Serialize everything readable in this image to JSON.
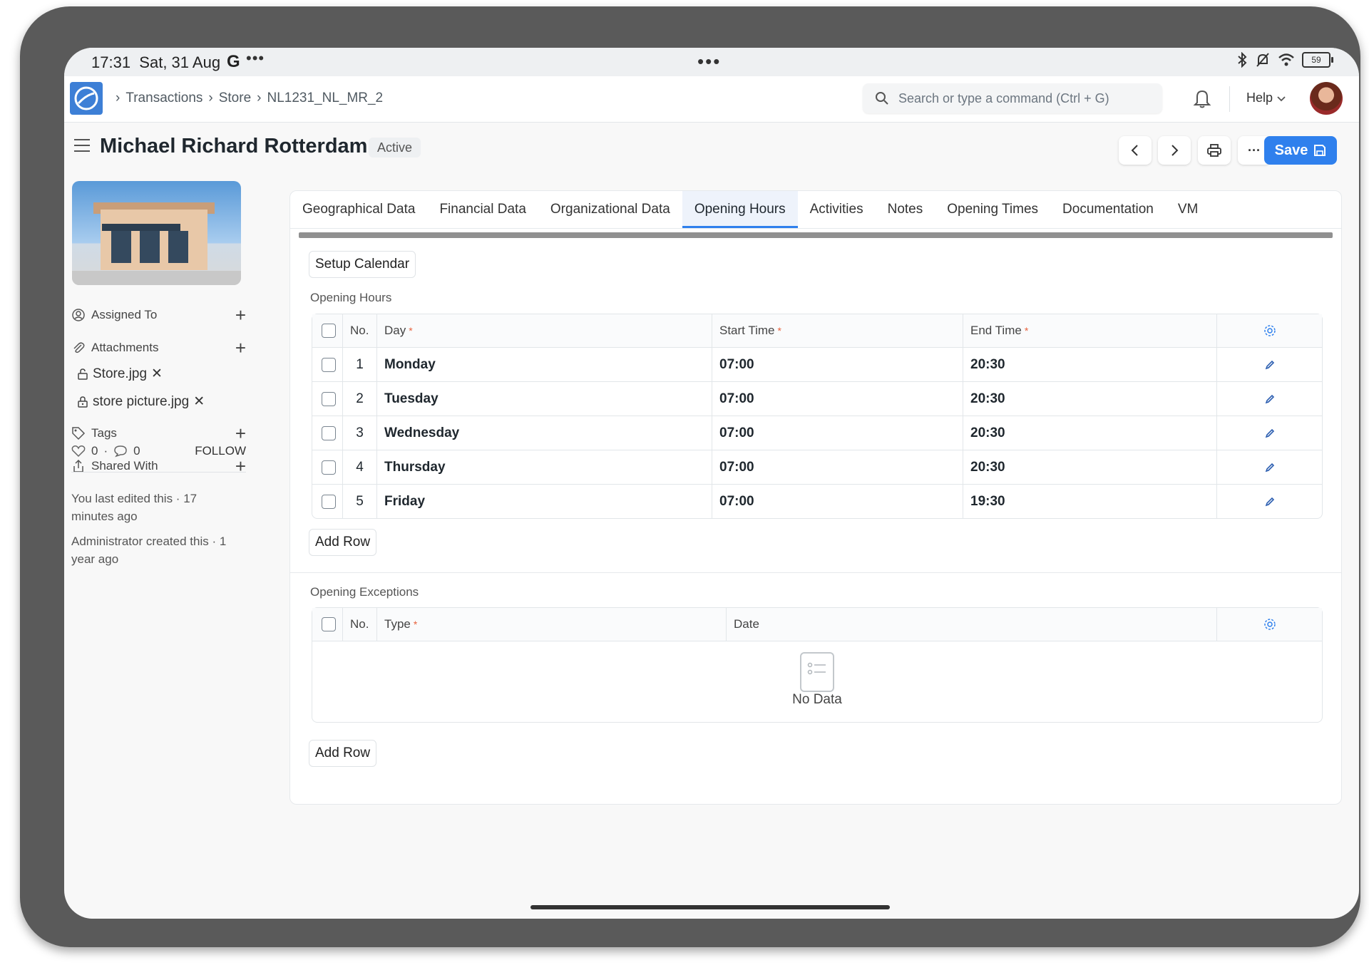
{
  "status_bar": {
    "time": "17:31",
    "date": "Sat, 31 Aug",
    "g": "G",
    "dots_left": "•••",
    "dots_center": "•••",
    "battery": "59"
  },
  "breadcrumb": {
    "sep": "›",
    "items": [
      "Transactions",
      "Store",
      "NL1231_NL_MR_2"
    ]
  },
  "search": {
    "placeholder": "Search or type a command (Ctrl + G)"
  },
  "help": {
    "label": "Help"
  },
  "page": {
    "title": "Michael Richard Rotterdam",
    "status": "Active"
  },
  "toolbar": {
    "save_label": "Save",
    "more_label": "···"
  },
  "sidebar": {
    "assigned_to": "Assigned To",
    "attachments": "Attachments",
    "files": [
      "Store.jpg",
      "store picture.jpg"
    ],
    "tags": "Tags",
    "shared_with": "Shared With",
    "likes": "0",
    "comments": "0",
    "dot": "·",
    "follow": "FOLLOW",
    "last_edited": "You last edited this · 17 minutes ago",
    "created": "Administrator created this · 1 year ago"
  },
  "tabs": [
    "Geographical Data",
    "Financial Data",
    "Organizational Data",
    "Opening Hours",
    "Activities",
    "Notes",
    "Opening Times",
    "Documentation",
    "VM"
  ],
  "setup_calendar": "Setup Calendar",
  "opening_hours": {
    "label": "Opening Hours",
    "headers": {
      "no": "No.",
      "day": "Day",
      "start": "Start Time",
      "end": "End Time"
    },
    "rows": [
      {
        "no": "1",
        "day": "Monday",
        "start": "07:00",
        "end": "20:30"
      },
      {
        "no": "2",
        "day": "Tuesday",
        "start": "07:00",
        "end": "20:30"
      },
      {
        "no": "3",
        "day": "Wednesday",
        "start": "07:00",
        "end": "20:30"
      },
      {
        "no": "4",
        "day": "Thursday",
        "start": "07:00",
        "end": "20:30"
      },
      {
        "no": "5",
        "day": "Friday",
        "start": "07:00",
        "end": "19:30"
      }
    ],
    "add_row": "Add Row"
  },
  "opening_exceptions": {
    "label": "Opening Exceptions",
    "headers": {
      "no": "No.",
      "type": "Type",
      "date": "Date"
    },
    "empty": "No Data",
    "add_row": "Add Row"
  },
  "colors": {
    "accent": "#2f80ed",
    "required": "#e8623d"
  }
}
